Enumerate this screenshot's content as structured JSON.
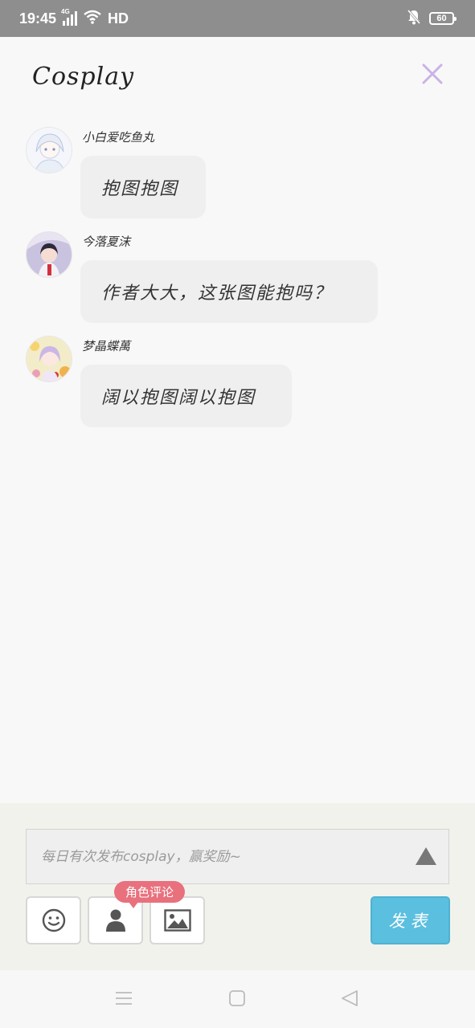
{
  "status_bar": {
    "time": "19:45",
    "network": "4G",
    "hd": "HD",
    "battery": "60",
    "icons": [
      "signal-icon",
      "wifi-icon",
      "mute-bell-icon",
      "battery-icon"
    ]
  },
  "header": {
    "title": "Cosplay",
    "close_icon": "close-icon",
    "close_color": "#c9b3e6"
  },
  "messages": [
    {
      "username": "小白爱吃鱼丸",
      "text": "抱图抱图",
      "avatar": "avatar-anime-girl-white"
    },
    {
      "username": "今落夏沫",
      "text": "作者大大，这张图能抱吗？",
      "avatar": "avatar-anime-girl-umbrella"
    },
    {
      "username": "梦晶蝶萬",
      "text": "阔以抱图阔以抱图",
      "avatar": "avatar-anime-girl-flowers"
    }
  ],
  "composer": {
    "placeholder": "每日有次发布cosplay，赢奖励~",
    "expand_icon": "triangle-up-icon",
    "tools": [
      "emoji-icon",
      "person-icon",
      "image-icon"
    ],
    "role_badge": "角色评论",
    "send_label": "发表",
    "send_color": "#5bbfdf",
    "badge_color": "#e8717d"
  },
  "nav": {
    "icons": [
      "menu-icon",
      "home-square-icon",
      "back-triangle-icon"
    ]
  }
}
